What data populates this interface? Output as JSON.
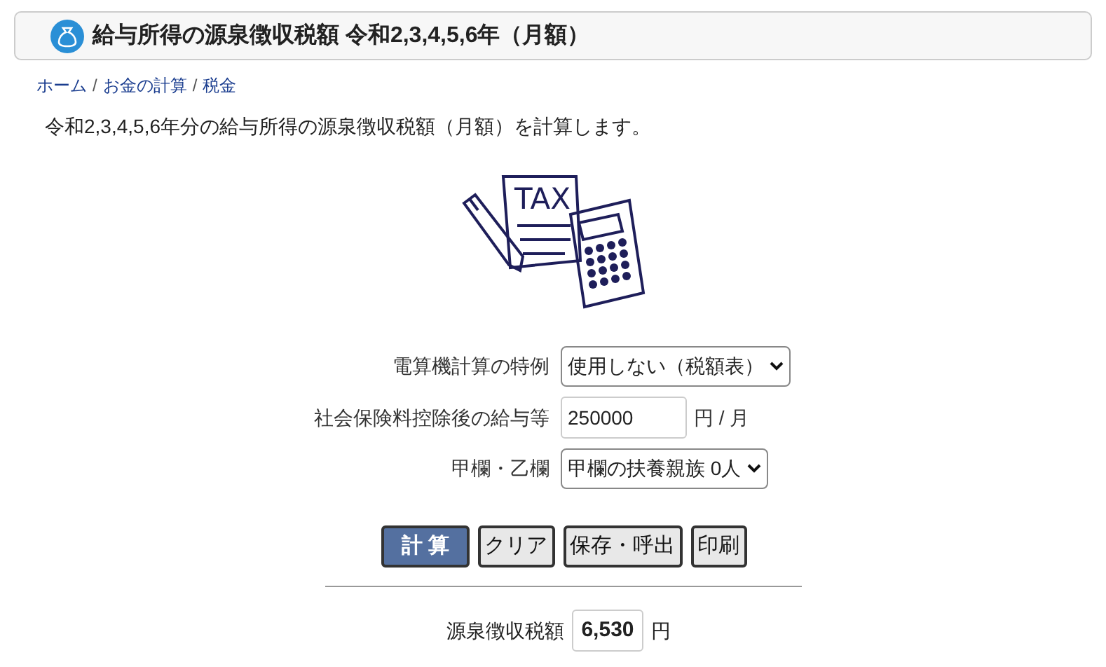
{
  "header": {
    "title": "給与所得の源泉徴収税額 令和2,3,4,5,6年（月額）"
  },
  "breadcrumb": [
    {
      "kind": "link",
      "text": "ホーム"
    },
    {
      "kind": "separator",
      "text": "/"
    },
    {
      "kind": "link",
      "text": "お金の計算"
    },
    {
      "kind": "separator",
      "text": "/"
    },
    {
      "kind": "link",
      "text": "税金"
    }
  ],
  "description": "令和2,3,4,5,6年分の給与所得の源泉徴収税額（月額）を計算します。",
  "illustration": {
    "label": "TAX"
  },
  "form": [
    {
      "kind": "select",
      "label": "電算機計算の特例",
      "value": "使用しない（税額表）"
    },
    {
      "kind": "input",
      "label": "社会保険料控除後の給与等",
      "value": "250000",
      "unit": "円 / 月"
    },
    {
      "kind": "select",
      "label": "甲欄・乙欄",
      "value": "甲欄の扶養親族 0人"
    }
  ],
  "buttons": [
    {
      "label": "計 算",
      "primary": true
    },
    {
      "label": "クリア",
      "primary": false
    },
    {
      "label": "保存・呼出",
      "primary": false
    },
    {
      "label": "印刷",
      "primary": false
    }
  ],
  "result": {
    "label": "源泉徴収税額",
    "value": "6,530",
    "unit": "円"
  }
}
